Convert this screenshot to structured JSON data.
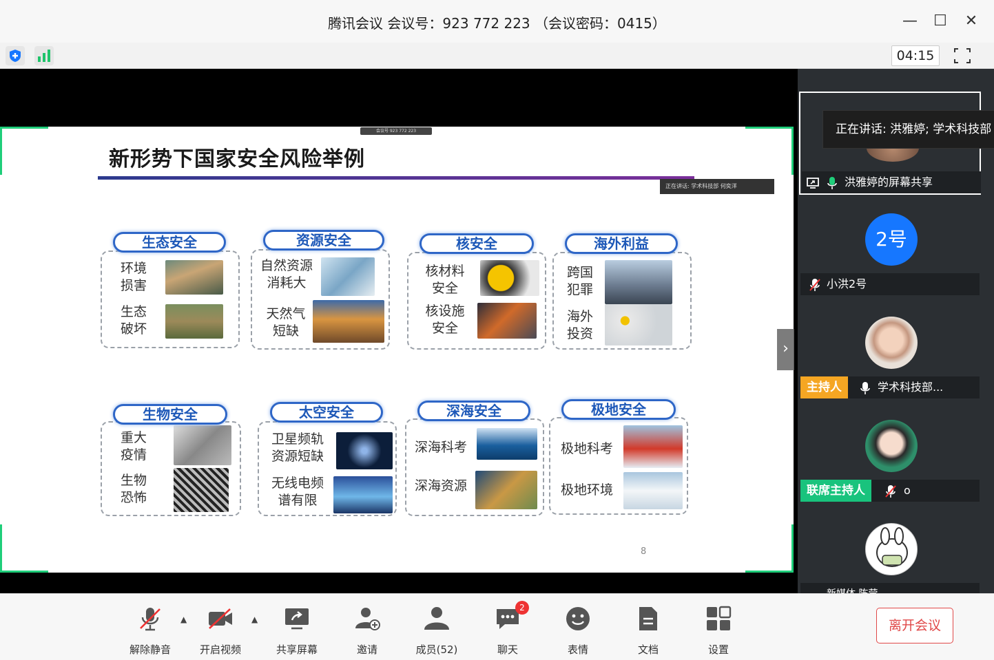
{
  "window": {
    "title": "腾讯会议 会议号：923 772 223 （会议密码：0415）",
    "minimize": "—",
    "maximize": "☐",
    "close": "✕"
  },
  "toolbar": {
    "timer": "04:15",
    "security_icon": "shield-icon",
    "signal_icon": "signal-icon"
  },
  "slide": {
    "title": "新形势下国家安全风险举例",
    "meeting_tag": "会议号 923 772 223",
    "speaker_tag": "正在讲话: 学术科技部 何奕洋",
    "page": "8",
    "cards": [
      {
        "head": "生态安全",
        "items": [
          "环境\n损害",
          "生态\n破坏"
        ]
      },
      {
        "head": "资源安全",
        "items": [
          "自然资源\n消耗大",
          "天然气\n短缺"
        ]
      },
      {
        "head": "核安全",
        "items": [
          "核材料\n安全",
          "核设施\n安全"
        ]
      },
      {
        "head": "海外利益",
        "items": [
          "跨国\n犯罪",
          "海外\n投资"
        ]
      },
      {
        "head": "生物安全",
        "items": [
          "重大\n疫情",
          "生物\n恐怖"
        ]
      },
      {
        "head": "太空安全",
        "items": [
          "卫星频轨\n资源短缺",
          "无线电频\n谱有限"
        ]
      },
      {
        "head": "深海安全",
        "items": [
          "深海科考",
          "深海资源"
        ]
      },
      {
        "head": "极地安全",
        "items": [
          "极地科考",
          "极地环境"
        ]
      }
    ]
  },
  "participants": {
    "talking": "正在讲话: 洪雅婷; 学术科技部",
    "items": [
      {
        "name": "洪雅婷的屏幕共享",
        "role": "",
        "avatar_text": ""
      },
      {
        "name": "小洪2号",
        "role": "",
        "avatar_text": "2号"
      },
      {
        "name": "学术科技部...",
        "role": "主持人",
        "avatar_text": ""
      },
      {
        "name": "o",
        "role": "联席主持人",
        "avatar_text": ""
      },
      {
        "name": "新媒体 陈莹",
        "role": "",
        "avatar_text": ""
      }
    ]
  },
  "bottom": {
    "unmute": "解除静音",
    "video": "开启视频",
    "share": "共享屏幕",
    "invite": "邀请",
    "members": "成员(52)",
    "chat": "聊天",
    "chat_badge": "2",
    "emoji": "表情",
    "docs": "文档",
    "settings": "设置",
    "leave": "离开会议"
  },
  "colors": {
    "accent_green": "#1fce7a",
    "danger": "#e04848",
    "host_orange": "#f5a623",
    "cohost_green": "#19c37d",
    "avatar_blue": "#1677ff"
  }
}
